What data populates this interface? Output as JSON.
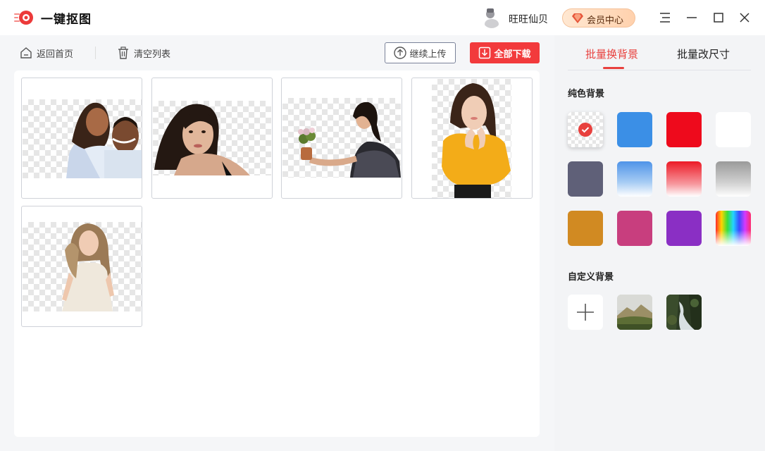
{
  "app": {
    "title": "一键抠图"
  },
  "user": {
    "name": "旺旺仙贝",
    "vip_label": "会员中心"
  },
  "colors": {
    "accent": "#e8403d",
    "download": "#f23a3c"
  },
  "toolbar": {
    "home_label": "返回首页",
    "clear_label": "清空列表",
    "upload_label": "继续上传",
    "download_label": "全部下载"
  },
  "images": [
    {
      "name": "couple-hugging"
    },
    {
      "name": "woman-long-hair"
    },
    {
      "name": "woman-holding-flowers"
    },
    {
      "name": "woman-yellow-top"
    },
    {
      "name": "woman-white-dress"
    }
  ],
  "panel": {
    "tabs": [
      {
        "label": "批量换背景",
        "active": true
      },
      {
        "label": "批量改尺寸",
        "active": false
      }
    ],
    "solid_title": "纯色背景",
    "custom_title": "自定义背景",
    "swatches": [
      {
        "name": "transparent",
        "selected": true
      },
      {
        "name": "blue",
        "color": "#3b8fe6"
      },
      {
        "name": "red",
        "color": "#ee0a1c"
      },
      {
        "name": "white",
        "color": "#ffffff"
      },
      {
        "name": "slate",
        "color": "#5f6078"
      },
      {
        "name": "blue-gradient",
        "color": "#4f93e8"
      },
      {
        "name": "red-gradient",
        "color": "#ec1a26"
      },
      {
        "name": "gray-gradient",
        "color": "#9a9a9a"
      },
      {
        "name": "amber",
        "color": "#d18a22"
      },
      {
        "name": "magenta",
        "color": "#c83e7e"
      },
      {
        "name": "purple",
        "color": "#8a2fc4"
      },
      {
        "name": "rainbow"
      }
    ],
    "custom_tiles": [
      {
        "name": "add-custom"
      },
      {
        "name": "mountain-landscape"
      },
      {
        "name": "waterfall-landscape"
      }
    ]
  }
}
